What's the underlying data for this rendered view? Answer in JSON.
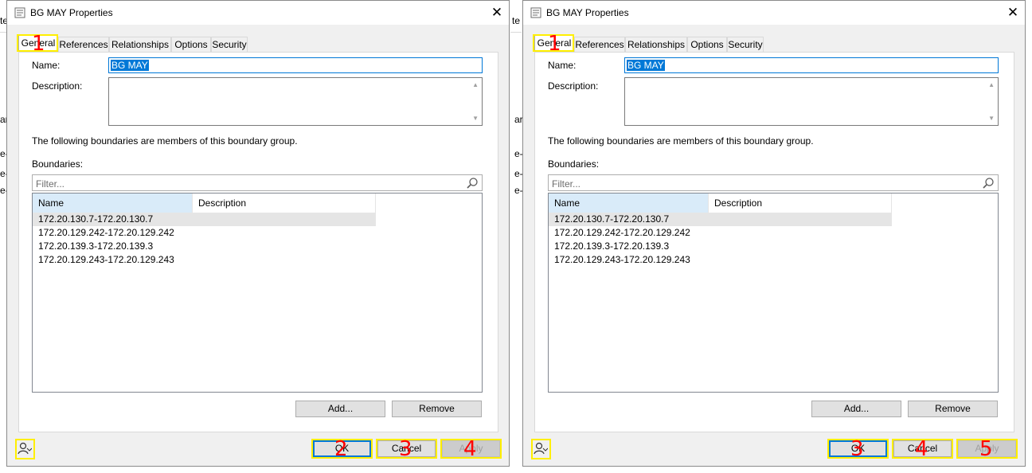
{
  "background": {
    "fragments": [
      "te",
      "ar",
      "e-",
      "e-",
      "e-"
    ]
  },
  "dialogs": [
    {
      "title": "BG MAY Properties",
      "close": "✕",
      "tabs": [
        "General",
        "References",
        "Relationships",
        "Options",
        "Security"
      ],
      "name_label": "Name:",
      "name_value": "BG MAY",
      "description_label": "Description:",
      "members_text": "The following boundaries are members of this boundary group.",
      "boundaries_label": "Boundaries:",
      "filter_placeholder": "Filter...",
      "columns": [
        "Name",
        "Description"
      ],
      "rows": [
        "172.20.130.7-172.20.130.7",
        "172.20.129.242-172.20.129.242",
        "172.20.139.3-172.20.139.3",
        "172.20.129.243-172.20.129.243"
      ],
      "add_button": "Add...",
      "remove_button": "Remove",
      "ok_button": "OK",
      "cancel_button": "Cancel",
      "apply_button": "Apply",
      "annotations": [
        "1",
        "2",
        "3",
        "4"
      ]
    },
    {
      "title": "BG MAY Properties",
      "close": "✕",
      "tabs": [
        "General",
        "References",
        "Relationships",
        "Options",
        "Security"
      ],
      "name_label": "Name:",
      "name_value": "BG MAY",
      "description_label": "Description:",
      "members_text": "The following boundaries are members of this boundary group.",
      "boundaries_label": "Boundaries:",
      "filter_placeholder": "Filter...",
      "columns": [
        "Name",
        "Description"
      ],
      "rows": [
        "172.20.130.7-172.20.130.7",
        "172.20.129.242-172.20.129.242",
        "172.20.139.3-172.20.139.3",
        "172.20.129.243-172.20.129.243"
      ],
      "add_button": "Add...",
      "remove_button": "Remove",
      "ok_button": "OK",
      "cancel_button": "Cancel",
      "apply_button": "Apply",
      "annotations": [
        "1",
        "3",
        "4",
        "5"
      ]
    }
  ],
  "colors": {
    "dialog_bg": "#f0f0f0",
    "selection": "#0078d7",
    "header_hover": "#d9ebf9",
    "highlight": "#ffef00",
    "annotation": "#ff0000"
  }
}
